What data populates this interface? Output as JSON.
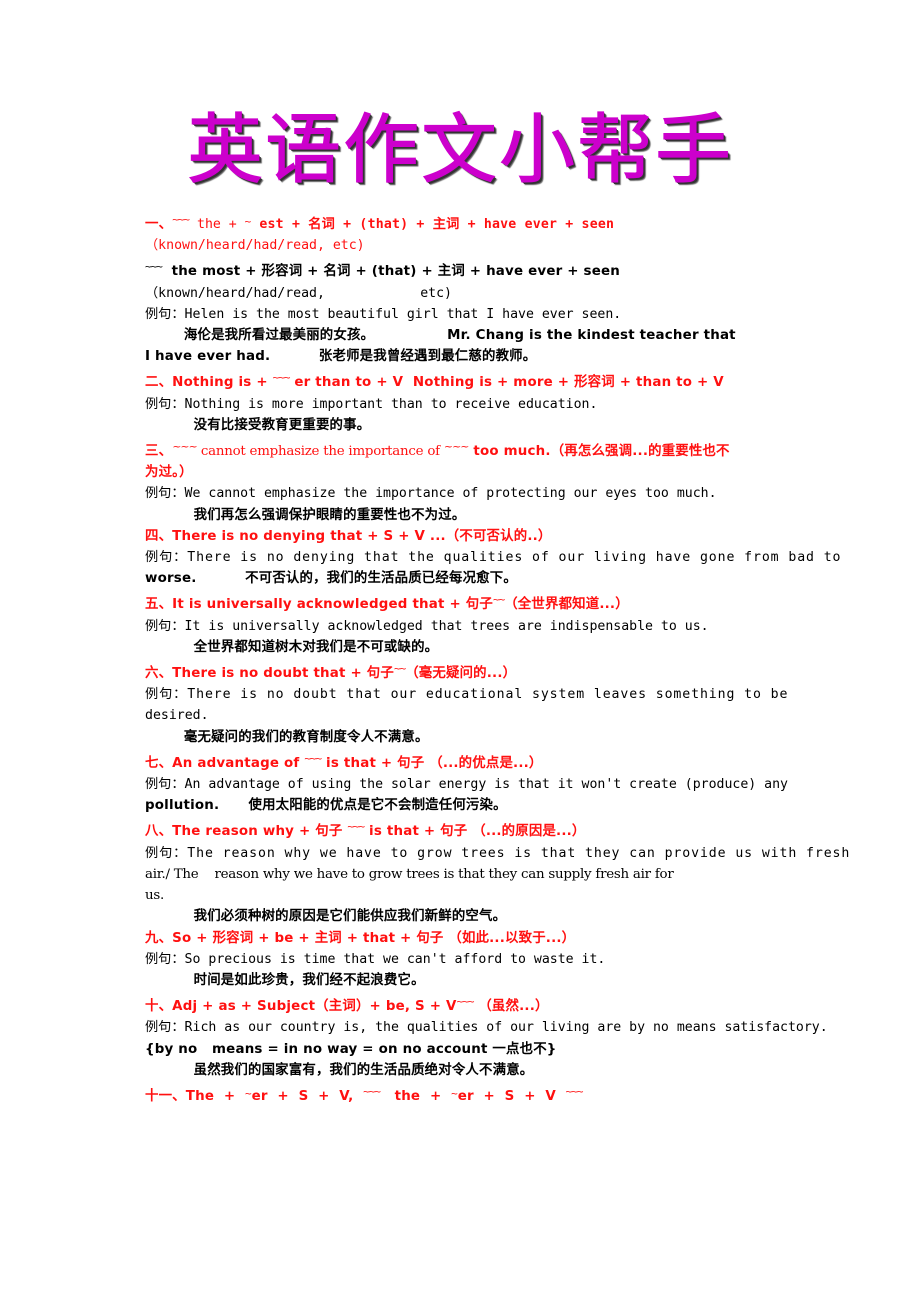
{
  "document": {
    "title": "英语作文小帮手",
    "title_color": "#cc00cc",
    "rule_color": "#ff1010",
    "body_color": "#000000",
    "background": "#ffffff",
    "example_marker": "例句："
  },
  "lines": {
    "l01": "一、",
    "l01b": " the + ",
    "l01c": " est + 名词 + (that) + 主词 + have ever + seen",
    "l02": "（known/heard/had/read, etc)",
    "l03b": "  the most + 形容词 + 名词 + (that) + 主词 + have ever + seen",
    "l04": "（known/heard/had/read,            etc)",
    "l05": "例句：Helen is the most beautiful girl that I have ever seen.",
    "l06": "        海伦是我所看过最美丽的女孩。               Mr. Chang is the kindest teacher that",
    "l07": "I have ever had.          张老师是我曾经遇到最仁慈的教师。",
    "l08a": "二、Nothing is + ",
    "l08b": " er than to + V  Nothing is + more + 形容词 + than to + V",
    "l09": "例句：Nothing is more important than to receive education.",
    "l10": "          没有比接受教育更重要的事。",
    "l11a": "三、",
    "l11b": " cannot emphasize the importance of ",
    "l11c": " too much.（再怎么强调...的重要性也不",
    "l12": "为过。）",
    "l13": "例句：We cannot emphasize the importance of protecting our eyes too much.",
    "l14": "          我们再怎么强调保护眼睛的重要性也不为过。",
    "l15": "四、There is no denying that + S + V ...（不可否认的..）",
    "l16": "例句：There is no denying that the qualities of our living have gone from bad to",
    "l17": "worse.          不可否认的，我们的生活品质已经每况愈下。",
    "l18a": "五、It is universally acknowledged that + 句子",
    "l18b": "（全世界都知道...）",
    "l19": "例句：It is universally acknowledged that trees are indispensable to us.",
    "l20": "          全世界都知道树木对我们是不可或缺的。",
    "l21a": "六、There is no doubt that + 句子",
    "l21b": "（毫无疑问的...）",
    "l22": "例句：There is no doubt that our educational system leaves something to be",
    "l23": "desired.",
    "l24": "        毫无疑问的我们的教育制度令人不满意。",
    "l25a": "七、An advantage of ",
    "l25b": " is that + 句子 （...的优点是...）",
    "l26": "例句：An advantage of using the solar energy is that it won't create (produce) any",
    "l27": "pollution.      使用太阳能的优点是它不会制造任何污染。",
    "l28a": "八、The reason why + 句子 ",
    "l28b": " is that + 句子 （...的原因是...）",
    "l29": "例句：The reason why we have to grow trees is that they can provide us with fresh",
    "l30": "air./ The    reason why we have to grow trees is that they can supply fresh air for",
    "l31": "us.",
    "l32": "          我们必须种树的原因是它们能供应我们新鲜的空气。",
    "l33": "九、So + 形容词 + be + 主词 + that + 句子 （如此...以致于...）",
    "l34": "例句：So precious is time that we can't afford to waste it.",
    "l35": "          时间是如此珍贵，我们经不起浪费它。",
    "l36a": "十、Adj + as + Subject（主词）+ be, S + V",
    "l36b": " （虽然...）",
    "l37": "例句：Rich as our country is, the qualities of our living are by no means satisfactory.",
    "l38": "{by no   means = in no way = on no account 一点也不}",
    "l39": "          虽然我们的国家富有，我们的生活品质绝对令人不满意。",
    "l40a": "十一、The  +  ",
    "l40b": "er  +  S  +  V,  ",
    "l40c": "   the  +  ",
    "l40d": "er  +  S  +  V  "
  },
  "glyphs": {
    "tilde_triple": "~~~",
    "tilde_single": "~",
    "tilde_double": "~~"
  }
}
